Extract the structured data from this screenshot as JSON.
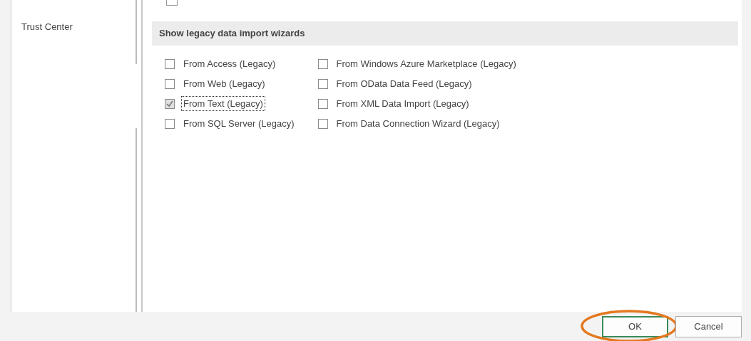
{
  "sidebar": {
    "items": [
      {
        "label": "Trust Center",
        "selected": false
      }
    ]
  },
  "cut_checkbox": {
    "checked": false
  },
  "section": {
    "heading": "Show legacy data import wizards",
    "columns": [
      [
        {
          "label": "From Access (Legacy)",
          "checked": false,
          "focused": false
        },
        {
          "label": "From Web (Legacy)",
          "checked": false,
          "focused": false
        },
        {
          "label": "From Text (Legacy)",
          "checked": true,
          "focused": true
        },
        {
          "label": "From SQL Server (Legacy)",
          "checked": false,
          "focused": false
        }
      ],
      [
        {
          "label": "From Windows Azure Marketplace (Legacy)",
          "checked": false,
          "focused": false
        },
        {
          "label": "From OData Data Feed (Legacy)",
          "checked": false,
          "focused": false
        },
        {
          "label": "From XML Data Import (Legacy)",
          "checked": false,
          "focused": false
        },
        {
          "label": "From Data Connection Wizard (Legacy)",
          "checked": false,
          "focused": false
        }
      ]
    ]
  },
  "buttons": [
    {
      "label": "OK",
      "kind": "default",
      "highlighted": true
    },
    {
      "label": "Cancel",
      "kind": "normal",
      "highlighted": false
    }
  ]
}
